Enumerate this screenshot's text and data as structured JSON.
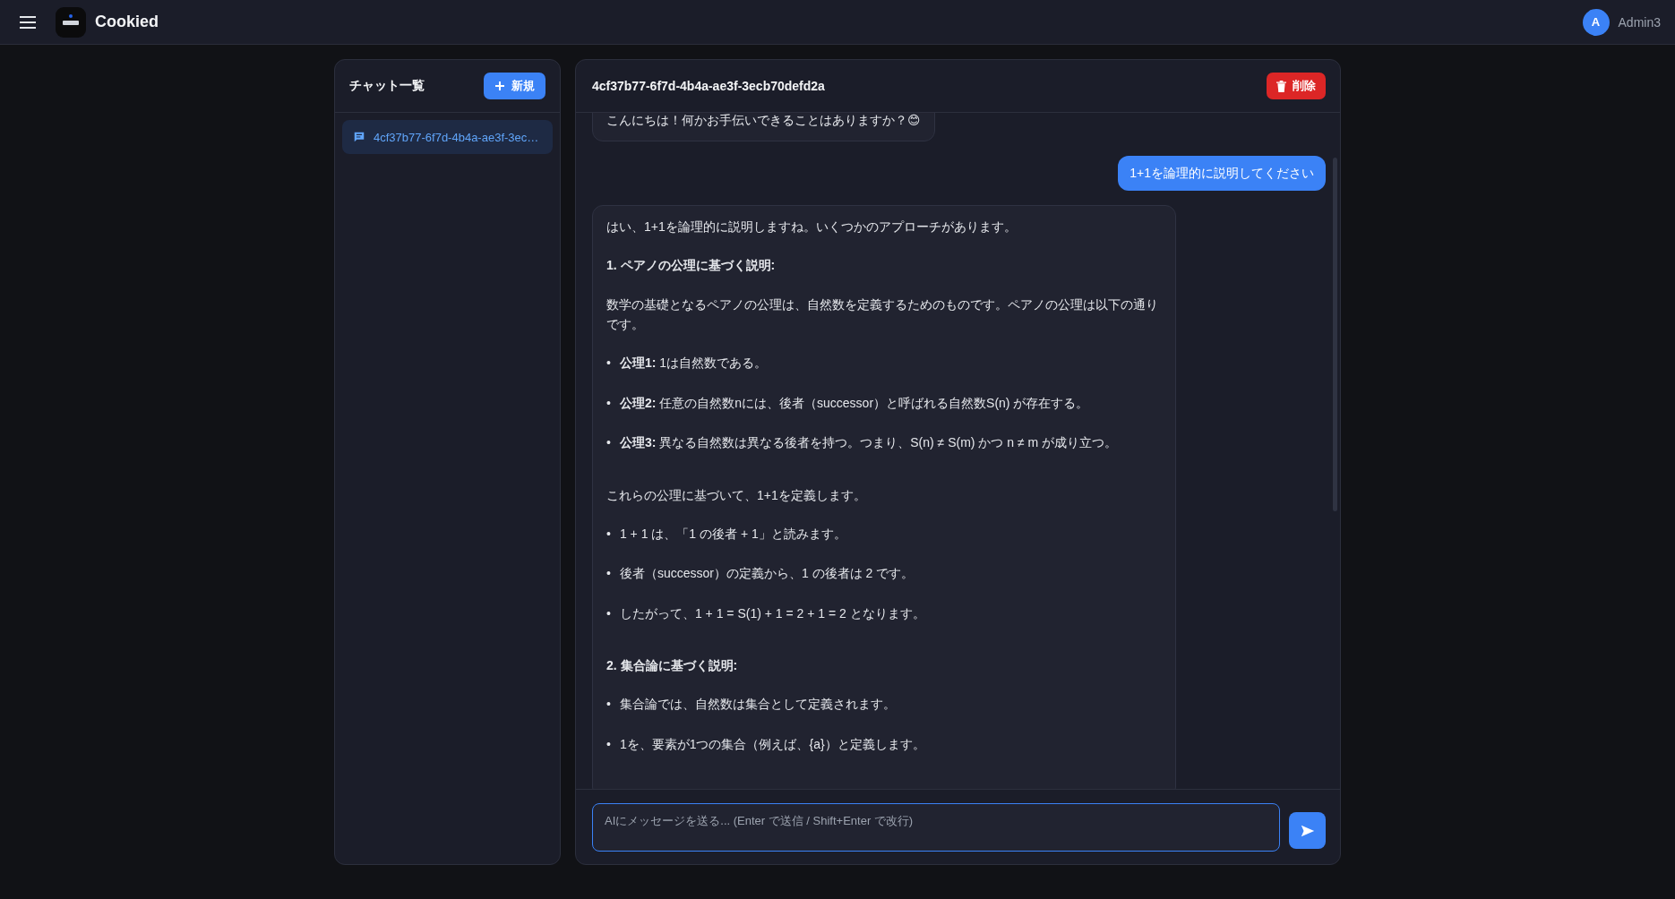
{
  "app": {
    "title": "Cookied",
    "user": {
      "initial": "A",
      "name": "Admin3"
    }
  },
  "sidebar": {
    "title": "チャット一覧",
    "new_button": "新規",
    "items": [
      {
        "label": "4cf37b77-6f7d-4b4a-ae3f-3ec…",
        "selected": true
      }
    ]
  },
  "chat": {
    "title": "4cf37b77-6f7d-4b4a-ae3f-3ecb70defd2a",
    "delete_button": "削除",
    "messages": [
      {
        "kind": "assistant",
        "blocks": [
          {
            "kind": "paragraph",
            "text": "こんにちは！何かお手伝いできることはありますか？😊"
          }
        ]
      },
      {
        "kind": "user",
        "blocks": [
          {
            "kind": "paragraph",
            "text": "1+1を論理的に説明してください"
          }
        ]
      },
      {
        "kind": "assistant",
        "blocks": [
          {
            "kind": "paragraph",
            "text": "はい、1+1を論理的に説明しますね。いくつかのアプローチがあります。"
          },
          {
            "kind": "heading",
            "text": "1. ペアノの公理に基づく説明:"
          },
          {
            "kind": "paragraph",
            "text": "数学の基礎となるペアノの公理は、自然数を定義するためのものです。ペアノの公理は以下の通りです。"
          },
          {
            "kind": "list",
            "items": [
              {
                "marker": "•",
                "text": "**公理1:** 1は自然数である。"
              },
              {
                "marker": "•",
                "text": "**公理2:** 任意の自然数nには、後者（successor）と呼ばれる自然数S(n) が存在する。"
              },
              {
                "marker": "•",
                "text": "**公理3:** 異なる自然数は異なる後者を持つ。つまり、S(n) ≠ S(m) かつ n ≠ m が成り立つ。"
              }
            ]
          },
          {
            "kind": "paragraph",
            "text": "これらの公理に基づいて、1+1を定義します。"
          },
          {
            "kind": "list",
            "items": [
              {
                "marker": "•",
                "text": "1 + 1 は、「1 の後者 + 1」と読みます。"
              },
              {
                "marker": "•",
                "text": "後者（successor）の定義から、1 の後者は 2 です。"
              },
              {
                "marker": "•",
                "text": "したがって、1 + 1 = S(1) + 1 = 2 + 1 = 2 となります。"
              }
            ]
          },
          {
            "kind": "heading",
            "text": "2. 集合論に基づく説明:"
          },
          {
            "kind": "list",
            "items": [
              {
                "marker": "•",
                "text": "集合論では、自然数は集合として定義されます。"
              },
              {
                "marker": "•",
                "text": "1を、要素が1つの集合（例えば、{a}）と定義します。"
              }
            ]
          }
        ]
      }
    ],
    "input": {
      "placeholder": "AIにメッセージを送る... (Enter で送信 / Shift+Enter で改行)"
    }
  }
}
